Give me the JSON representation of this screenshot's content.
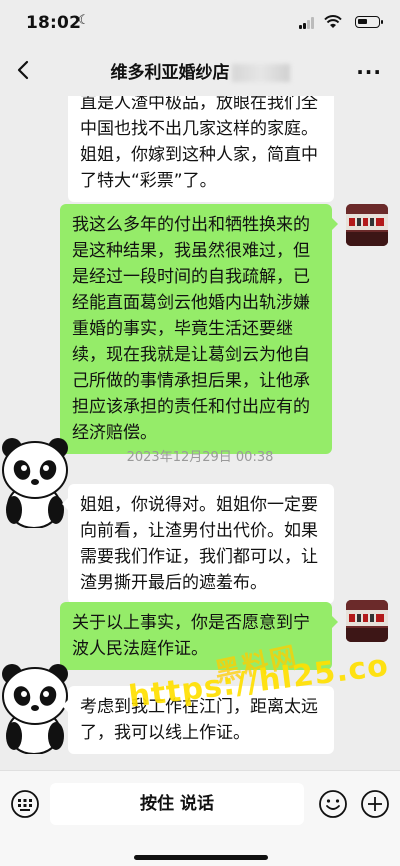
{
  "status_bar": {
    "time": "18:02"
  },
  "header": {
    "title": "维多利亚婚纱店"
  },
  "messages": [
    {
      "side": "left",
      "text": "直是人渣中极品，放眼在我们全中国也找不出几家这样的家庭。姐姐，你嫁到这种人家，简直中了特大“彩票”了。"
    },
    {
      "side": "right",
      "text": "我这么多年的付出和牺牲换来的是这种结果，我虽然很难过，但是经过一段时间的自我疏解，已经能直面葛剑云他婚内出轨涉嫌重婚的事实，毕竟生活还要继续，现在我就是让葛剑云为他自己所做的事情承担后果，让他承担应该承担的责任和付出应有的经济赔偿。"
    },
    {
      "side": "time",
      "text": "2023年12月29日 00:38"
    },
    {
      "side": "left",
      "text": "姐姐，你说得对。姐姐你一定要向前看，让渣男付出代价。如果需要我们作证，我们都可以，让渣男撕开最后的遮羞布。"
    },
    {
      "side": "right",
      "text": "关于以上事实，你是否愿意到宁波人民法庭作证。"
    },
    {
      "side": "left",
      "text": "考虑到我工作在江门，距离太远了，我可以线上作证。"
    }
  ],
  "watermark": {
    "cn": "黑料网",
    "url": "https://hl25.co"
  },
  "input_bar": {
    "hold_to_talk": "按住 说话"
  },
  "colors": {
    "bg": "#ededed",
    "self_bubble": "#95ec69",
    "other_bubble": "#ffffff"
  }
}
